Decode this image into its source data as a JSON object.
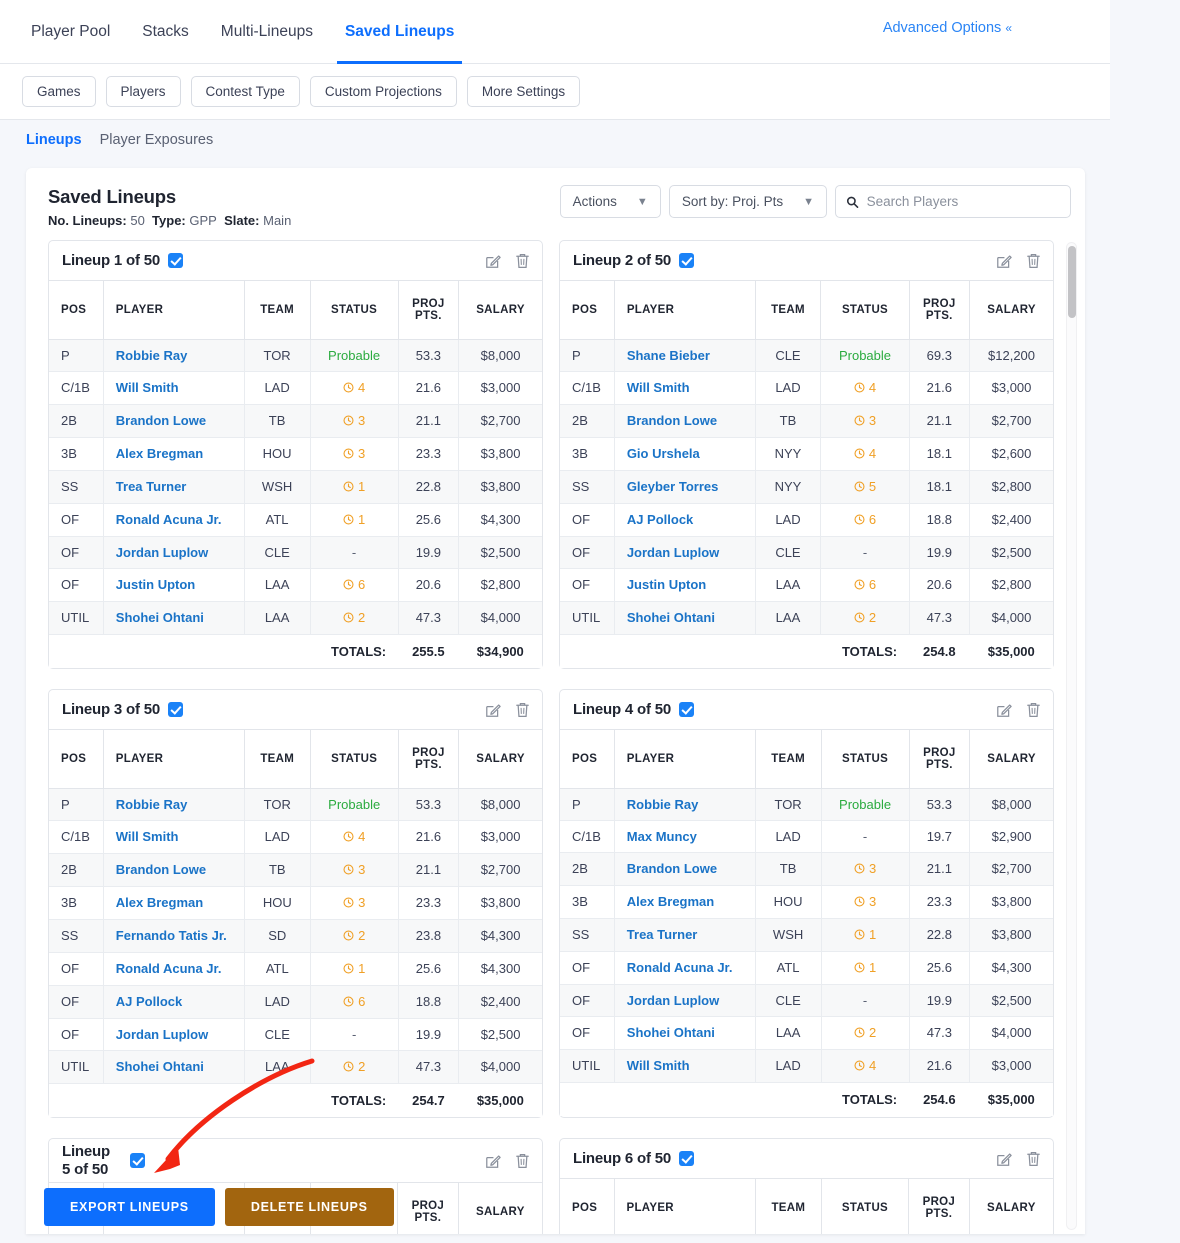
{
  "nav": {
    "tabs": [
      {
        "label": "Player Pool",
        "active": false
      },
      {
        "label": "Stacks",
        "active": false
      },
      {
        "label": "Multi-Lineups",
        "active": false
      },
      {
        "label": "Saved Lineups",
        "active": true
      }
    ],
    "advanced_options": "Advanced Options",
    "advanced_chevron": "«"
  },
  "filters": [
    "Games",
    "Players",
    "Contest Type",
    "Custom Projections",
    "More Settings"
  ],
  "subtabs": [
    {
      "label": "Lineups",
      "active": true
    },
    {
      "label": "Player Exposures",
      "active": false
    }
  ],
  "card": {
    "title": "Saved Lineups",
    "meta": {
      "no_lineups_label": "No. Lineups:",
      "no_lineups_value": "50",
      "type_label": "Type:",
      "type_value": "GPP",
      "slate_label": "Slate:",
      "slate_value": "Main"
    },
    "actions_label": "Actions",
    "sort_label": "Sort by: Proj. Pts",
    "search_placeholder": "Search Players",
    "search_value": ""
  },
  "table_headers": [
    "POS",
    "PLAYER",
    "TEAM",
    "STATUS",
    "PROJ PTS.",
    "SALARY"
  ],
  "totals_label": "TOTALS:",
  "lineups": [
    {
      "title": "Lineup 1 of 50",
      "checked": true,
      "rows": [
        {
          "pos": "P",
          "player": "Robbie Ray",
          "team": "TOR",
          "status": "Probable",
          "status_type": "probable",
          "proj": "53.3",
          "salary": "$8,000"
        },
        {
          "pos": "C/1B",
          "player": "Will Smith",
          "team": "LAD",
          "status": "4",
          "status_type": "clock",
          "proj": "21.6",
          "salary": "$3,000"
        },
        {
          "pos": "2B",
          "player": "Brandon Lowe",
          "team": "TB",
          "status": "3",
          "status_type": "clock",
          "proj": "21.1",
          "salary": "$2,700"
        },
        {
          "pos": "3B",
          "player": "Alex Bregman",
          "team": "HOU",
          "status": "3",
          "status_type": "clock",
          "proj": "23.3",
          "salary": "$3,800"
        },
        {
          "pos": "SS",
          "player": "Trea Turner",
          "team": "WSH",
          "status": "1",
          "status_type": "clock",
          "proj": "22.8",
          "salary": "$3,800"
        },
        {
          "pos": "OF",
          "player": "Ronald Acuna Jr.",
          "team": "ATL",
          "status": "1",
          "status_type": "clock",
          "proj": "25.6",
          "salary": "$4,300"
        },
        {
          "pos": "OF",
          "player": "Jordan Luplow",
          "team": "CLE",
          "status": "-",
          "status_type": "dash",
          "proj": "19.9",
          "salary": "$2,500"
        },
        {
          "pos": "OF",
          "player": "Justin Upton",
          "team": "LAA",
          "status": "6",
          "status_type": "clock",
          "proj": "20.6",
          "salary": "$2,800"
        },
        {
          "pos": "UTIL",
          "player": "Shohei Ohtani",
          "team": "LAA",
          "status": "2",
          "status_type": "clock",
          "proj": "47.3",
          "salary": "$4,000"
        }
      ],
      "total_proj": "255.5",
      "total_salary": "$34,900"
    },
    {
      "title": "Lineup 2 of 50",
      "checked": true,
      "rows": [
        {
          "pos": "P",
          "player": "Shane Bieber",
          "team": "CLE",
          "status": "Probable",
          "status_type": "probable",
          "proj": "69.3",
          "salary": "$12,200"
        },
        {
          "pos": "C/1B",
          "player": "Will Smith",
          "team": "LAD",
          "status": "4",
          "status_type": "clock",
          "proj": "21.6",
          "salary": "$3,000"
        },
        {
          "pos": "2B",
          "player": "Brandon Lowe",
          "team": "TB",
          "status": "3",
          "status_type": "clock",
          "proj": "21.1",
          "salary": "$2,700"
        },
        {
          "pos": "3B",
          "player": "Gio Urshela",
          "team": "NYY",
          "status": "4",
          "status_type": "clock",
          "proj": "18.1",
          "salary": "$2,600"
        },
        {
          "pos": "SS",
          "player": "Gleyber Torres",
          "team": "NYY",
          "status": "5",
          "status_type": "clock",
          "proj": "18.1",
          "salary": "$2,800"
        },
        {
          "pos": "OF",
          "player": "AJ Pollock",
          "team": "LAD",
          "status": "6",
          "status_type": "clock",
          "proj": "18.8",
          "salary": "$2,400"
        },
        {
          "pos": "OF",
          "player": "Jordan Luplow",
          "team": "CLE",
          "status": "-",
          "status_type": "dash",
          "proj": "19.9",
          "salary": "$2,500"
        },
        {
          "pos": "OF",
          "player": "Justin Upton",
          "team": "LAA",
          "status": "6",
          "status_type": "clock",
          "proj": "20.6",
          "salary": "$2,800"
        },
        {
          "pos": "UTIL",
          "player": "Shohei Ohtani",
          "team": "LAA",
          "status": "2",
          "status_type": "clock",
          "proj": "47.3",
          "salary": "$4,000"
        }
      ],
      "total_proj": "254.8",
      "total_salary": "$35,000"
    },
    {
      "title": "Lineup 3 of 50",
      "checked": true,
      "rows": [
        {
          "pos": "P",
          "player": "Robbie Ray",
          "team": "TOR",
          "status": "Probable",
          "status_type": "probable",
          "proj": "53.3",
          "salary": "$8,000"
        },
        {
          "pos": "C/1B",
          "player": "Will Smith",
          "team": "LAD",
          "status": "4",
          "status_type": "clock",
          "proj": "21.6",
          "salary": "$3,000"
        },
        {
          "pos": "2B",
          "player": "Brandon Lowe",
          "team": "TB",
          "status": "3",
          "status_type": "clock",
          "proj": "21.1",
          "salary": "$2,700"
        },
        {
          "pos": "3B",
          "player": "Alex Bregman",
          "team": "HOU",
          "status": "3",
          "status_type": "clock",
          "proj": "23.3",
          "salary": "$3,800"
        },
        {
          "pos": "SS",
          "player": "Fernando Tatis Jr.",
          "team": "SD",
          "status": "2",
          "status_type": "clock",
          "proj": "23.8",
          "salary": "$4,300"
        },
        {
          "pos": "OF",
          "player": "Ronald Acuna Jr.",
          "team": "ATL",
          "status": "1",
          "status_type": "clock",
          "proj": "25.6",
          "salary": "$4,300"
        },
        {
          "pos": "OF",
          "player": "AJ Pollock",
          "team": "LAD",
          "status": "6",
          "status_type": "clock",
          "proj": "18.8",
          "salary": "$2,400"
        },
        {
          "pos": "OF",
          "player": "Jordan Luplow",
          "team": "CLE",
          "status": "-",
          "status_type": "dash",
          "proj": "19.9",
          "salary": "$2,500"
        },
        {
          "pos": "UTIL",
          "player": "Shohei Ohtani",
          "team": "LAA",
          "status": "2",
          "status_type": "clock",
          "proj": "47.3",
          "salary": "$4,000"
        }
      ],
      "total_proj": "254.7",
      "total_salary": "$35,000"
    },
    {
      "title": "Lineup 4 of 50",
      "checked": true,
      "rows": [
        {
          "pos": "P",
          "player": "Robbie Ray",
          "team": "TOR",
          "status": "Probable",
          "status_type": "probable",
          "proj": "53.3",
          "salary": "$8,000"
        },
        {
          "pos": "C/1B",
          "player": "Max Muncy",
          "team": "LAD",
          "status": "-",
          "status_type": "dash",
          "proj": "19.7",
          "salary": "$2,900"
        },
        {
          "pos": "2B",
          "player": "Brandon Lowe",
          "team": "TB",
          "status": "3",
          "status_type": "clock",
          "proj": "21.1",
          "salary": "$2,700"
        },
        {
          "pos": "3B",
          "player": "Alex Bregman",
          "team": "HOU",
          "status": "3",
          "status_type": "clock",
          "proj": "23.3",
          "salary": "$3,800"
        },
        {
          "pos": "SS",
          "player": "Trea Turner",
          "team": "WSH",
          "status": "1",
          "status_type": "clock",
          "proj": "22.8",
          "salary": "$3,800"
        },
        {
          "pos": "OF",
          "player": "Ronald Acuna Jr.",
          "team": "ATL",
          "status": "1",
          "status_type": "clock",
          "proj": "25.6",
          "salary": "$4,300"
        },
        {
          "pos": "OF",
          "player": "Jordan Luplow",
          "team": "CLE",
          "status": "-",
          "status_type": "dash",
          "proj": "19.9",
          "salary": "$2,500"
        },
        {
          "pos": "OF",
          "player": "Shohei Ohtani",
          "team": "LAA",
          "status": "2",
          "status_type": "clock",
          "proj": "47.3",
          "salary": "$4,000"
        },
        {
          "pos": "UTIL",
          "player": "Will Smith",
          "team": "LAD",
          "status": "4",
          "status_type": "clock",
          "proj": "21.6",
          "salary": "$3,000"
        }
      ],
      "total_proj": "254.6",
      "total_salary": "$35,000"
    },
    {
      "title": "Lineup 5 of 50",
      "checked": true,
      "rows": [],
      "total_proj": "",
      "total_salary": ""
    },
    {
      "title": "Lineup 6 of 50",
      "checked": true,
      "rows": [],
      "total_proj": "",
      "total_salary": ""
    }
  ],
  "footer": {
    "export_label": "EXPORT LINEUPS",
    "delete_label": "DELETE LINEUPS"
  },
  "colors": {
    "accent": "#0d6efd",
    "link": "#1a73c7",
    "probable": "#2bab3f",
    "clock": "#f0a026",
    "delete_btn": "#a2650f",
    "annotation": "#f22613"
  }
}
